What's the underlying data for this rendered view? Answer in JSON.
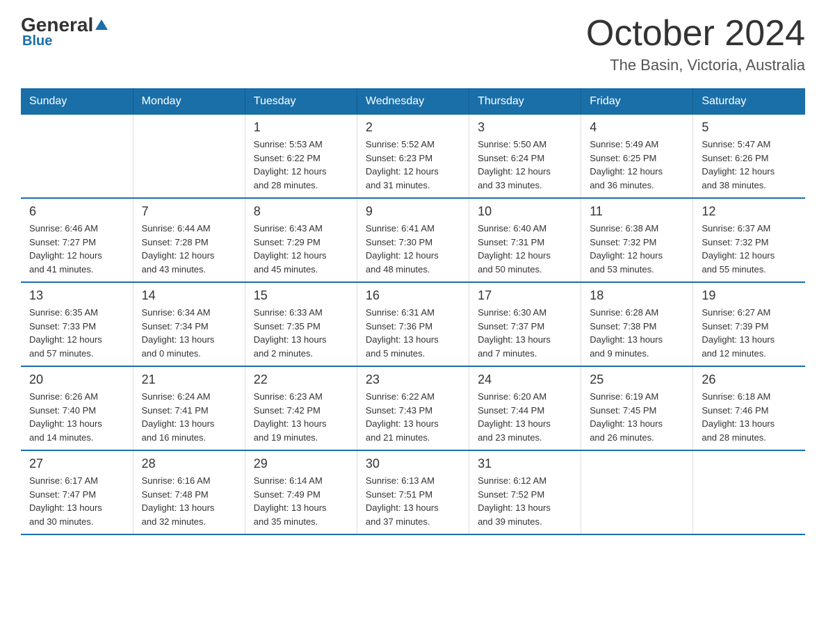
{
  "logo": {
    "general": "General",
    "blue": "Blue",
    "triangle": "▲"
  },
  "header": {
    "title": "October 2024",
    "subtitle": "The Basin, Victoria, Australia"
  },
  "days_of_week": [
    "Sunday",
    "Monday",
    "Tuesday",
    "Wednesday",
    "Thursday",
    "Friday",
    "Saturday"
  ],
  "weeks": [
    [
      {
        "day": "",
        "info": ""
      },
      {
        "day": "",
        "info": ""
      },
      {
        "day": "1",
        "info": "Sunrise: 5:53 AM\nSunset: 6:22 PM\nDaylight: 12 hours\nand 28 minutes."
      },
      {
        "day": "2",
        "info": "Sunrise: 5:52 AM\nSunset: 6:23 PM\nDaylight: 12 hours\nand 31 minutes."
      },
      {
        "day": "3",
        "info": "Sunrise: 5:50 AM\nSunset: 6:24 PM\nDaylight: 12 hours\nand 33 minutes."
      },
      {
        "day": "4",
        "info": "Sunrise: 5:49 AM\nSunset: 6:25 PM\nDaylight: 12 hours\nand 36 minutes."
      },
      {
        "day": "5",
        "info": "Sunrise: 5:47 AM\nSunset: 6:26 PM\nDaylight: 12 hours\nand 38 minutes."
      }
    ],
    [
      {
        "day": "6",
        "info": "Sunrise: 6:46 AM\nSunset: 7:27 PM\nDaylight: 12 hours\nand 41 minutes."
      },
      {
        "day": "7",
        "info": "Sunrise: 6:44 AM\nSunset: 7:28 PM\nDaylight: 12 hours\nand 43 minutes."
      },
      {
        "day": "8",
        "info": "Sunrise: 6:43 AM\nSunset: 7:29 PM\nDaylight: 12 hours\nand 45 minutes."
      },
      {
        "day": "9",
        "info": "Sunrise: 6:41 AM\nSunset: 7:30 PM\nDaylight: 12 hours\nand 48 minutes."
      },
      {
        "day": "10",
        "info": "Sunrise: 6:40 AM\nSunset: 7:31 PM\nDaylight: 12 hours\nand 50 minutes."
      },
      {
        "day": "11",
        "info": "Sunrise: 6:38 AM\nSunset: 7:32 PM\nDaylight: 12 hours\nand 53 minutes."
      },
      {
        "day": "12",
        "info": "Sunrise: 6:37 AM\nSunset: 7:32 PM\nDaylight: 12 hours\nand 55 minutes."
      }
    ],
    [
      {
        "day": "13",
        "info": "Sunrise: 6:35 AM\nSunset: 7:33 PM\nDaylight: 12 hours\nand 57 minutes."
      },
      {
        "day": "14",
        "info": "Sunrise: 6:34 AM\nSunset: 7:34 PM\nDaylight: 13 hours\nand 0 minutes."
      },
      {
        "day": "15",
        "info": "Sunrise: 6:33 AM\nSunset: 7:35 PM\nDaylight: 13 hours\nand 2 minutes."
      },
      {
        "day": "16",
        "info": "Sunrise: 6:31 AM\nSunset: 7:36 PM\nDaylight: 13 hours\nand 5 minutes."
      },
      {
        "day": "17",
        "info": "Sunrise: 6:30 AM\nSunset: 7:37 PM\nDaylight: 13 hours\nand 7 minutes."
      },
      {
        "day": "18",
        "info": "Sunrise: 6:28 AM\nSunset: 7:38 PM\nDaylight: 13 hours\nand 9 minutes."
      },
      {
        "day": "19",
        "info": "Sunrise: 6:27 AM\nSunset: 7:39 PM\nDaylight: 13 hours\nand 12 minutes."
      }
    ],
    [
      {
        "day": "20",
        "info": "Sunrise: 6:26 AM\nSunset: 7:40 PM\nDaylight: 13 hours\nand 14 minutes."
      },
      {
        "day": "21",
        "info": "Sunrise: 6:24 AM\nSunset: 7:41 PM\nDaylight: 13 hours\nand 16 minutes."
      },
      {
        "day": "22",
        "info": "Sunrise: 6:23 AM\nSunset: 7:42 PM\nDaylight: 13 hours\nand 19 minutes."
      },
      {
        "day": "23",
        "info": "Sunrise: 6:22 AM\nSunset: 7:43 PM\nDaylight: 13 hours\nand 21 minutes."
      },
      {
        "day": "24",
        "info": "Sunrise: 6:20 AM\nSunset: 7:44 PM\nDaylight: 13 hours\nand 23 minutes."
      },
      {
        "day": "25",
        "info": "Sunrise: 6:19 AM\nSunset: 7:45 PM\nDaylight: 13 hours\nand 26 minutes."
      },
      {
        "day": "26",
        "info": "Sunrise: 6:18 AM\nSunset: 7:46 PM\nDaylight: 13 hours\nand 28 minutes."
      }
    ],
    [
      {
        "day": "27",
        "info": "Sunrise: 6:17 AM\nSunset: 7:47 PM\nDaylight: 13 hours\nand 30 minutes."
      },
      {
        "day": "28",
        "info": "Sunrise: 6:16 AM\nSunset: 7:48 PM\nDaylight: 13 hours\nand 32 minutes."
      },
      {
        "day": "29",
        "info": "Sunrise: 6:14 AM\nSunset: 7:49 PM\nDaylight: 13 hours\nand 35 minutes."
      },
      {
        "day": "30",
        "info": "Sunrise: 6:13 AM\nSunset: 7:51 PM\nDaylight: 13 hours\nand 37 minutes."
      },
      {
        "day": "31",
        "info": "Sunrise: 6:12 AM\nSunset: 7:52 PM\nDaylight: 13 hours\nand 39 minutes."
      },
      {
        "day": "",
        "info": ""
      },
      {
        "day": "",
        "info": ""
      }
    ]
  ]
}
